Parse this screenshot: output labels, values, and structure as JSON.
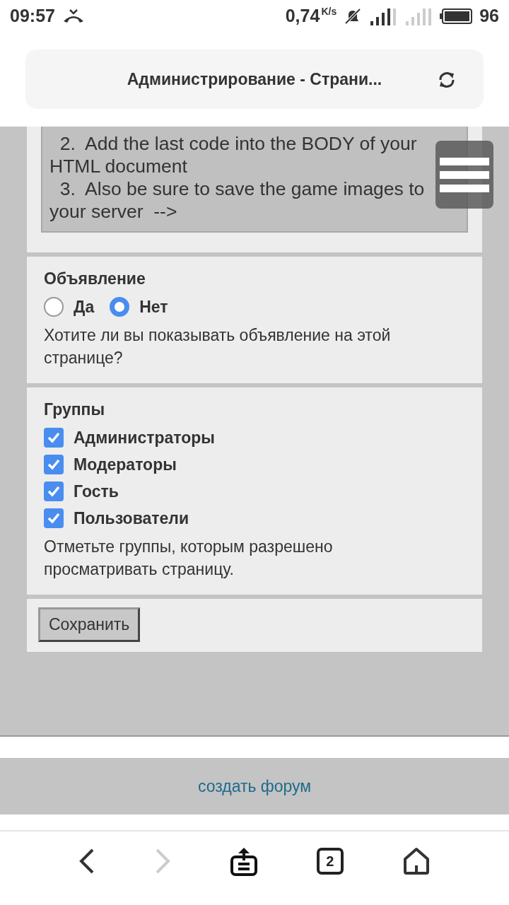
{
  "status_bar": {
    "time": "09:57",
    "speed": "0,74",
    "speed_unit": "K/s",
    "battery": "96"
  },
  "address_bar": {
    "title": "Администрирование - Страни..."
  },
  "code_box": {
    "value": "  2.  Add the last code into the BODY of your HTML document\n  3.  Also be sure to save the game images to your server  -->"
  },
  "announcement": {
    "label": "Объявление",
    "options": [
      {
        "label": "Да",
        "selected": false
      },
      {
        "label": "Нет",
        "selected": true
      }
    ],
    "hint": "Хотите ли вы показывать объявление на этой странице?"
  },
  "groups": {
    "label": "Группы",
    "items": [
      {
        "label": "Администраторы",
        "checked": true
      },
      {
        "label": "Модераторы",
        "checked": true
      },
      {
        "label": "Гость",
        "checked": true
      },
      {
        "label": "Пользователи",
        "checked": true
      }
    ],
    "hint": "Отметьте группы, которым разрешено просматривать страницу."
  },
  "save_button": "Сохранить",
  "footer_link": "создать форум",
  "nav": {
    "tabs_count": "2"
  }
}
